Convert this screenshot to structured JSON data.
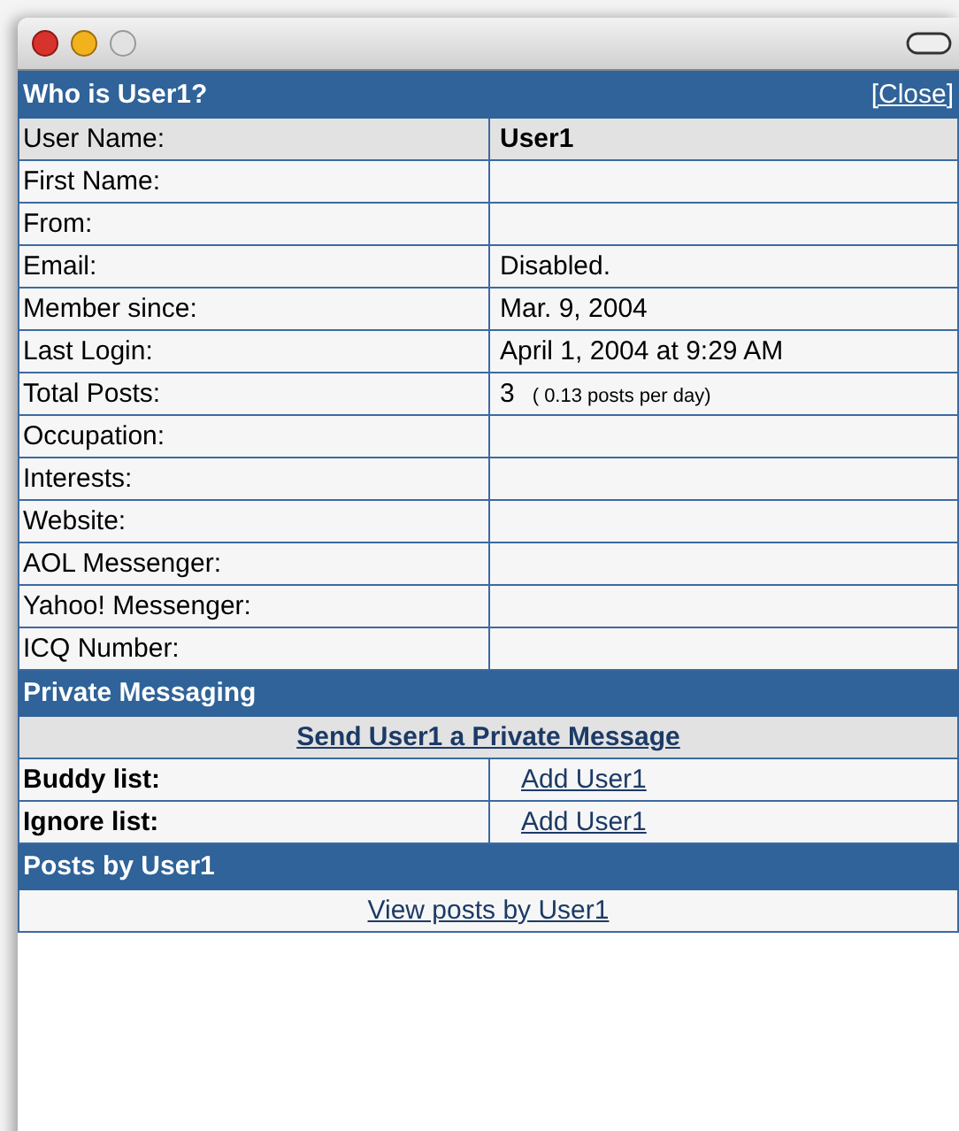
{
  "panel": {
    "title": "Who is User1?",
    "close_link": "[Close]"
  },
  "fields": [
    {
      "label": "User Name:",
      "value": "User1",
      "highlighted": true
    },
    {
      "label": "First Name:",
      "highlighted": false
    },
    {
      "label": "From:",
      "highlighted": false
    },
    {
      "label": "Email:",
      "value": "Disabled.",
      "highlighted": false
    },
    {
      "label": "Member since:",
      "value": "Mar. 9, 2004",
      "highlighted": false
    },
    {
      "label": "Last Login:",
      "value": "April 1, 2004 at 9:29 AM",
      "highlighted": false
    },
    {
      "label": "Total Posts:",
      "value": "3",
      "note": "( 0.13 posts per day)",
      "highlighted": false
    },
    {
      "label": "Occupation:",
      "highlighted": false
    },
    {
      "label": "Interests:",
      "highlighted": false
    },
    {
      "label": "Website:",
      "highlighted": false
    },
    {
      "label": "AOL Messenger:",
      "highlighted": false
    },
    {
      "label": "Yahoo! Messenger:",
      "highlighted": false
    },
    {
      "label": "ICQ Number:",
      "highlighted": false
    }
  ],
  "private_messaging": {
    "title": "Private Messaging",
    "send_link": "Send User1 a Private Message",
    "lists": [
      {
        "label": "Buddy list:",
        "link": "Add User1"
      },
      {
        "label": "Ignore list:",
        "link": "Add User1"
      }
    ]
  },
  "posts": {
    "title": "Posts by User1",
    "link": "View posts by User1"
  }
}
